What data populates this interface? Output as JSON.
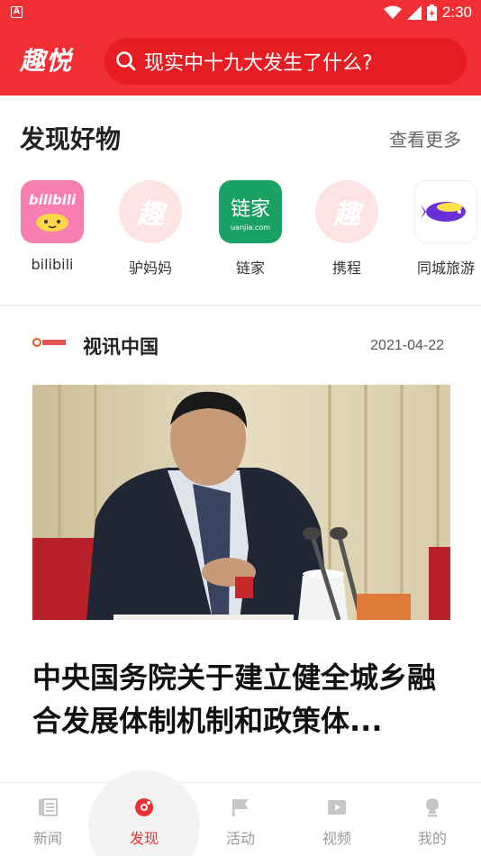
{
  "status_bar": {
    "left_icon": "A",
    "time": "2:30",
    "icons": [
      "wifi-icon",
      "signal-icon",
      "battery-icon"
    ]
  },
  "app_bar": {
    "logo": "趣悦",
    "search_placeholder": "现实中十九大发生了什么?"
  },
  "discover": {
    "title": "发现好物",
    "more": "查看更多",
    "apps": [
      {
        "label": "bilibili",
        "icon": "bilibili-icon",
        "icon_text": "bilibili"
      },
      {
        "label": "驴妈妈",
        "icon": "qu-icon",
        "icon_text": "趣"
      },
      {
        "label": "链家",
        "icon": "lianjia-icon",
        "icon_text": "链家",
        "icon_subtext": "uanjia.com"
      },
      {
        "label": "携程",
        "icon": "qu-icon",
        "icon_text": "趣"
      },
      {
        "label": "同城旅游",
        "icon": "tongcheng-icon"
      }
    ]
  },
  "article": {
    "source": "视讯中国",
    "source_logo_text": "视讯中国",
    "date": "2021-04-22",
    "title": "中央国务院关于建立健全城乡融合发展体制机制和政策体..."
  },
  "bottom_nav": {
    "items": [
      {
        "label": "新闻",
        "icon": "news-icon",
        "active": false
      },
      {
        "label": "发现",
        "icon": "discover-icon",
        "active": true
      },
      {
        "label": "活动",
        "icon": "flag-icon",
        "active": false
      },
      {
        "label": "视频",
        "icon": "video-icon",
        "active": false
      },
      {
        "label": "我的",
        "icon": "profile-icon",
        "active": false
      }
    ]
  },
  "colors": {
    "brand_red": "#ef2f33",
    "inactive_gray": "#999999"
  }
}
